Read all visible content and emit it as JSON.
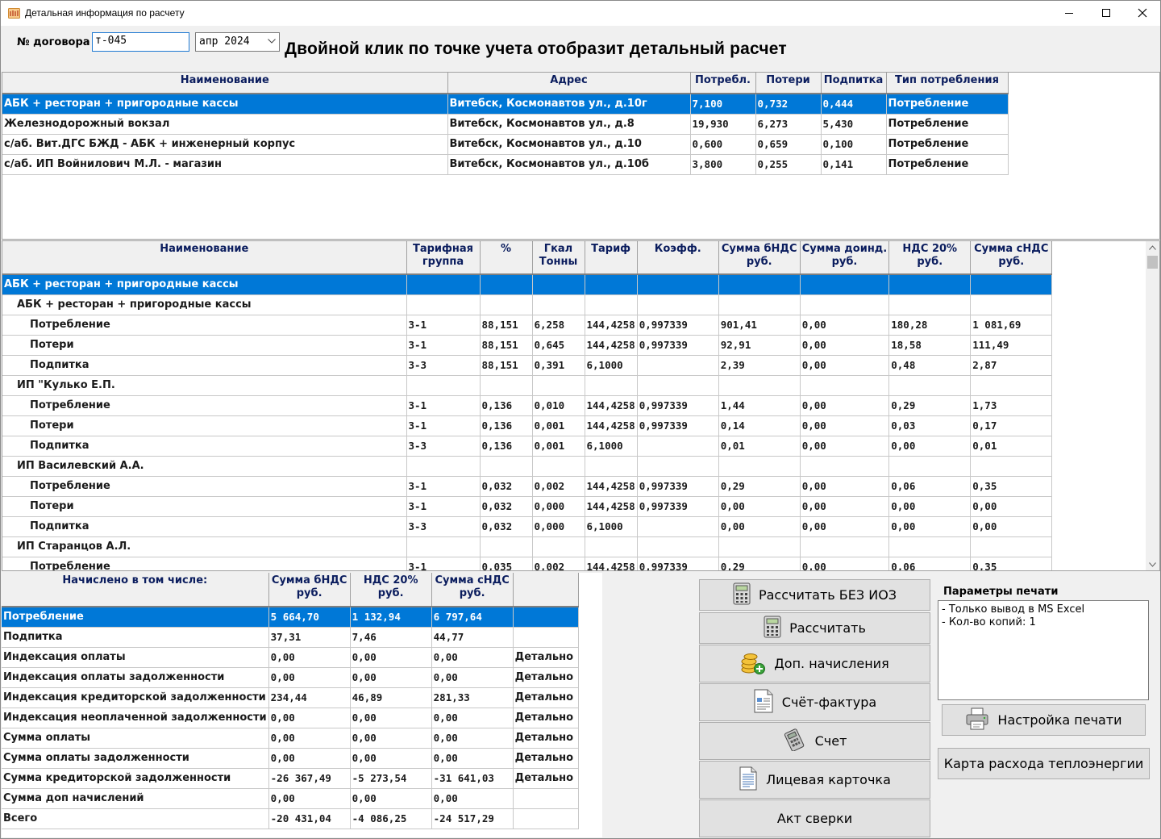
{
  "window": {
    "title": "Детальная информация по расчету"
  },
  "filters": {
    "contract_label": "№ договора",
    "contract_value": "т-045",
    "period_value": "апр 2024",
    "hint": "Двойной клик по точке учета отобразит детальный расчет"
  },
  "points": {
    "headers": [
      "Наименование",
      "Адрес",
      "Потребл.",
      "Потери",
      "Подпитка",
      "Тип потребления"
    ],
    "rows": [
      [
        "АБК + ресторан + пригородные кассы",
        "Витебск, Космонавтов ул., д.10г",
        "7,100",
        "0,732",
        "0,444",
        "Потребление"
      ],
      [
        "Железнодорожный вокзал",
        "Витебск, Космонавтов ул., д.8",
        "19,930",
        "6,273",
        "5,430",
        "Потребление"
      ],
      [
        "с/аб. Вит.ДГС БЖД - АБК + инженерный корпус",
        "Витебск, Космонавтов ул., д.10",
        "0,600",
        "0,659",
        "0,100",
        "Потребление"
      ],
      [
        "с/аб. ИП Войнилович М.Л. - магазин",
        "Витебск, Космонавтов ул., д.10б",
        "3,800",
        "0,255",
        "0,141",
        "Потребление"
      ]
    ]
  },
  "detail": {
    "headers": [
      [
        "Наименование",
        ""
      ],
      [
        "Тарифная",
        "группа"
      ],
      [
        "%",
        ""
      ],
      [
        "Гкал",
        "Тонны"
      ],
      [
        "Тариф",
        ""
      ],
      [
        "Коэфф.",
        ""
      ],
      [
        "Сумма бНДС",
        "руб."
      ],
      [
        "Сумма доинд.",
        "руб."
      ],
      [
        "НДС 20%",
        "руб."
      ],
      [
        "Сумма сНДС",
        "руб."
      ]
    ],
    "rows": [
      {
        "level": 0,
        "cells": [
          "АБК + ресторан + пригородные кассы",
          "",
          "",
          "",
          "",
          "",
          "",
          "",
          "",
          ""
        ]
      },
      {
        "level": 1,
        "cells": [
          "АБК +  ресторан + пригородные кассы",
          "",
          "",
          "",
          "",
          "",
          "",
          "",
          "",
          ""
        ]
      },
      {
        "level": 2,
        "cells": [
          "Потребление",
          "3-1",
          "88,151",
          "6,258",
          "144,4258",
          "0,997339",
          "901,41",
          "0,00",
          "180,28",
          "1 081,69"
        ]
      },
      {
        "level": 2,
        "cells": [
          "Потери",
          "3-1",
          "88,151",
          "0,645",
          "144,4258",
          "0,997339",
          "92,91",
          "0,00",
          "18,58",
          "111,49"
        ]
      },
      {
        "level": 2,
        "cells": [
          "Подпитка",
          "3-3",
          "88,151",
          "0,391",
          "6,1000",
          "",
          "2,39",
          "0,00",
          "0,48",
          "2,87"
        ]
      },
      {
        "level": 1,
        "cells": [
          "ИП \"Кулько Е.П.",
          "",
          "",
          "",
          "",
          "",
          "",
          "",
          "",
          ""
        ]
      },
      {
        "level": 2,
        "cells": [
          "Потребление",
          "3-1",
          "0,136",
          "0,010",
          "144,4258",
          "0,997339",
          "1,44",
          "0,00",
          "0,29",
          "1,73"
        ]
      },
      {
        "level": 2,
        "cells": [
          "Потери",
          "3-1",
          "0,136",
          "0,001",
          "144,4258",
          "0,997339",
          "0,14",
          "0,00",
          "0,03",
          "0,17"
        ]
      },
      {
        "level": 2,
        "cells": [
          "Подпитка",
          "3-3",
          "0,136",
          "0,001",
          "6,1000",
          "",
          "0,01",
          "0,00",
          "0,00",
          "0,01"
        ]
      },
      {
        "level": 1,
        "cells": [
          "ИП Василевский А.А.",
          "",
          "",
          "",
          "",
          "",
          "",
          "",
          "",
          ""
        ]
      },
      {
        "level": 2,
        "cells": [
          "Потребление",
          "3-1",
          "0,032",
          "0,002",
          "144,4258",
          "0,997339",
          "0,29",
          "0,00",
          "0,06",
          "0,35"
        ]
      },
      {
        "level": 2,
        "cells": [
          "Потери",
          "3-1",
          "0,032",
          "0,000",
          "144,4258",
          "0,997339",
          "0,00",
          "0,00",
          "0,00",
          "0,00"
        ]
      },
      {
        "level": 2,
        "cells": [
          "Подпитка",
          "3-3",
          "0,032",
          "0,000",
          "6,1000",
          "",
          "0,00",
          "0,00",
          "0,00",
          "0,00"
        ]
      },
      {
        "level": 1,
        "cells": [
          "ИП Старанцов А.Л.",
          "",
          "",
          "",
          "",
          "",
          "",
          "",
          "",
          ""
        ]
      },
      {
        "level": 2,
        "cells": [
          "Потребление",
          "3-1",
          "0,035",
          "0,002",
          "144,4258",
          "0,997339",
          "0,29",
          "0,00",
          "0,06",
          "0,35"
        ]
      }
    ]
  },
  "summary": {
    "headers": [
      [
        "Начислено в том числе:",
        ""
      ],
      [
        "Сумма бНДС",
        "руб."
      ],
      [
        "НДС 20%",
        "руб."
      ],
      [
        "Сумма сНДС",
        "руб."
      ],
      [
        "",
        ""
      ]
    ],
    "rows": [
      [
        "Потребление",
        "5 664,70",
        "1 132,94",
        "6 797,64",
        ""
      ],
      [
        "Подпитка",
        "37,31",
        "7,46",
        "44,77",
        ""
      ],
      [
        "Индексация оплаты",
        "0,00",
        "0,00",
        "0,00",
        "Детально"
      ],
      [
        "Индексация оплаты задолженности",
        "0,00",
        "0,00",
        "0,00",
        "Детально"
      ],
      [
        "Индексация кредиторской задолженности",
        "234,44",
        "46,89",
        "281,33",
        "Детально"
      ],
      [
        "Индексация неоплаченной задолженности",
        "0,00",
        "0,00",
        "0,00",
        "Детально"
      ],
      [
        "Сумма оплаты",
        "0,00",
        "0,00",
        "0,00",
        "Детально"
      ],
      [
        "Сумма оплаты задолженности",
        "0,00",
        "0,00",
        "0,00",
        "Детально"
      ],
      [
        "Сумма кредиторской задолженности",
        "-26 367,49",
        "-5 273,54",
        "-31 641,03",
        "Детально"
      ],
      [
        "Сумма доп начислений",
        "0,00",
        "0,00",
        "0,00",
        ""
      ],
      [
        "Всего",
        "-20 431,04",
        "-4 086,25",
        "-24 517,29",
        ""
      ]
    ]
  },
  "actions": {
    "calc_no_ioz": "Рассчитать БЕЗ ИОЗ",
    "calc": "Рассчитать",
    "extra_charges": "Доп. начисления",
    "invoice": "Счёт-фактура",
    "bill": "Счет",
    "account_card": "Лицевая карточка",
    "reconciliation": "Акт сверки"
  },
  "print": {
    "group_label": "Параметры печати",
    "params": [
      "- Только вывод в MS Excel",
      "- Кол-во копий: 1"
    ],
    "settings_button": "Настройка печати",
    "heat_map_button": "Карта расхода теплоэнергии"
  },
  "colors": {
    "selection": "#0078d7",
    "header_text": "#0b1d5e",
    "window_bg": "#f0f0f0"
  }
}
